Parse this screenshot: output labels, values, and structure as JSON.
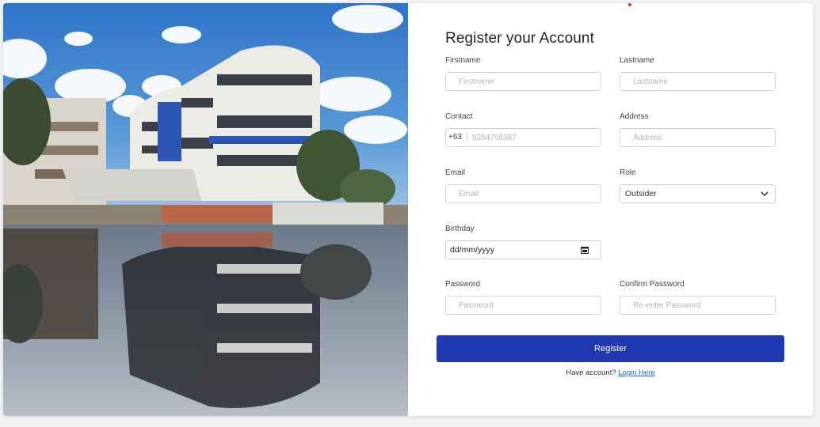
{
  "form": {
    "title": "Register your Account",
    "firstname": {
      "label": "Firstname",
      "placeholder": "Firstname"
    },
    "lastname": {
      "label": "Lastname",
      "placeholder": "Lastname"
    },
    "contact": {
      "label": "Contact",
      "prefix": "+63",
      "placeholder": "9354758387"
    },
    "address": {
      "label": "Address",
      "placeholder": "Address"
    },
    "email": {
      "label": "Email",
      "placeholder": "Email"
    },
    "role": {
      "label": "Role",
      "selected": "Outsider"
    },
    "birthday": {
      "label": "Birthday",
      "value": "dd/mm/yyyy"
    },
    "password": {
      "label": "Password",
      "placeholder": "Password"
    },
    "confirm_password": {
      "label": "Confirm Password",
      "placeholder": "Re-enter Password"
    },
    "register_label": "Register",
    "have_account_text": "Have account?",
    "login_link": "Login Here"
  },
  "colors": {
    "primary": "#1f39b3",
    "link": "#1a5fd8",
    "sky": "#3d7fd0"
  },
  "icons": {
    "select": "chevron-down-icon",
    "date": "calendar-icon"
  }
}
